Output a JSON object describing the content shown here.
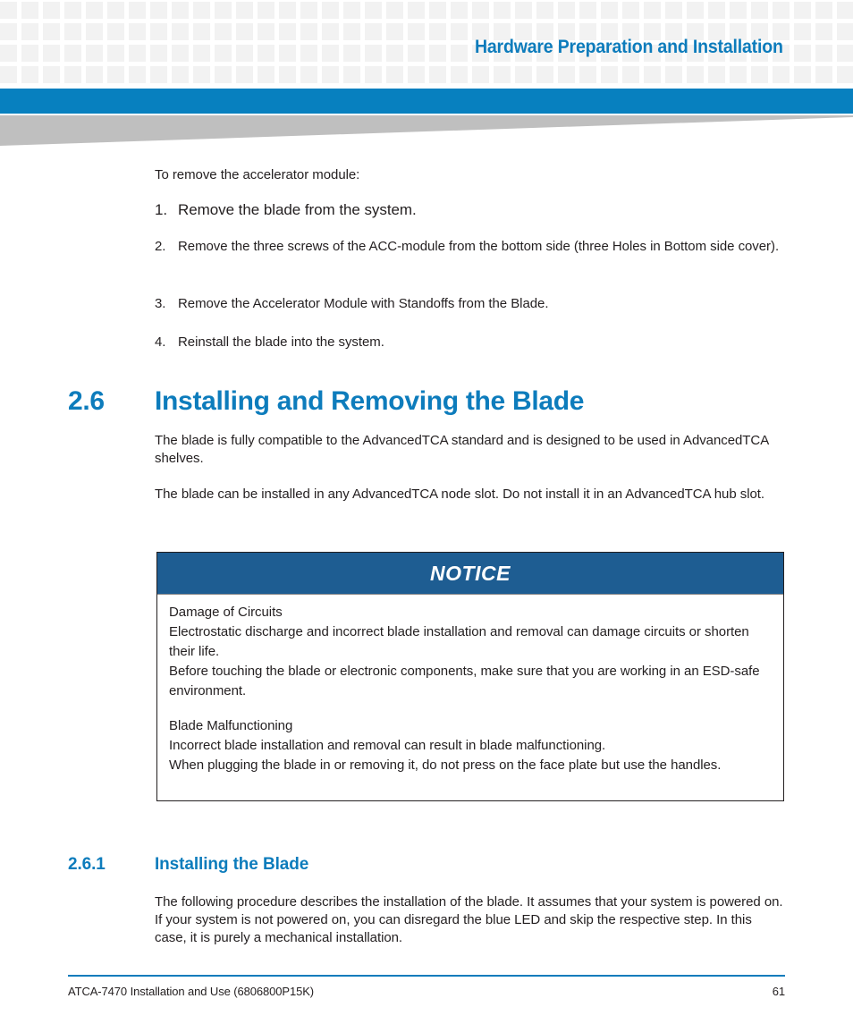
{
  "header": {
    "title": "Hardware Preparation and Installation",
    "accent_blue": "#0780bf",
    "title_color": "#0d7cbc",
    "wedge_color": "#bfbfbf",
    "grid_square_color": "#f2f2f2"
  },
  "intro": {
    "lead": "To remove the accelerator module:",
    "steps": [
      {
        "num": "1.",
        "text": "Remove the blade from the system."
      },
      {
        "num": "2.",
        "text": "Remove the three screws of the ACC-module from the bottom side (three Holes in Bottom side cover)."
      },
      {
        "num": "3.",
        "text": "Remove the Accelerator Module with Standoffs from the Blade."
      },
      {
        "num": "4.",
        "text": "Reinstall the blade into the system."
      }
    ]
  },
  "section": {
    "number": "2.6",
    "title": "Installing and Removing the Blade",
    "paragraphs": [
      "The blade is fully compatible to the AdvancedTCA standard and is designed to be used in AdvancedTCA shelves.",
      "The blade can be installed in any AdvancedTCA node slot. Do not install it in an AdvancedTCA hub slot."
    ]
  },
  "notice": {
    "label": "NOTICE",
    "band_color": "#1e5d92",
    "groups": [
      {
        "lines": [
          "Damage of Circuits",
          "Electrostatic discharge and incorrect blade installation and removal can damage circuits or shorten their life.",
          "Before touching the blade or electronic components, make sure that you are working in an ESD-safe environment."
        ]
      },
      {
        "lines": [
          "Blade Malfunctioning",
          "Incorrect blade installation and removal can result in blade malfunctioning.",
          "When plugging the blade in or removing it, do not press on the face plate but use the handles."
        ]
      }
    ]
  },
  "subsection": {
    "number": "2.6.1",
    "title": "Installing the Blade",
    "paragraph": "The following procedure describes the installation of the blade. It assumes that your system is powered on. If your system is not powered on, you can disregard the blue LED and skip the respective step. In this case, it is purely a mechanical installation."
  },
  "footer": {
    "document": "ATCA-7470 Installation and Use (6806800P15K)",
    "page_number": "61",
    "rule_color": "#0d7cbc"
  }
}
